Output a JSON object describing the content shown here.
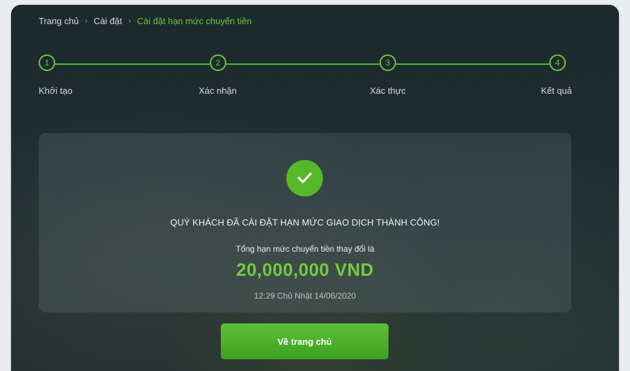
{
  "breadcrumb": {
    "items": [
      "Trang chủ",
      "Cài đặt"
    ],
    "current": "Cài đặt hạn mức chuyển tiền",
    "separator": "›"
  },
  "steps": [
    {
      "number": "1",
      "label": "Khởi tạo"
    },
    {
      "number": "2",
      "label": "Xác nhận"
    },
    {
      "number": "3",
      "label": "Xác thực"
    },
    {
      "number": "4",
      "label": "Kết quả"
    }
  ],
  "result": {
    "message": "QUÝ KHÁCH ĐÃ CÀI ĐẶT HẠN MỨC GIAO DỊCH THÀNH CÔNG!",
    "limit_label": "Tổng hạn mức chuyển tiền thay đổi là",
    "amount": "20,000,000 VND",
    "timestamp": "12:29 Chủ Nhật 14/06/2020",
    "icon": "checkmark-icon"
  },
  "actions": {
    "home_button": "Về trang chủ"
  },
  "colors": {
    "accent": "#6ec53e",
    "success_fill": "#55b72a",
    "background": "#1f2d31"
  }
}
